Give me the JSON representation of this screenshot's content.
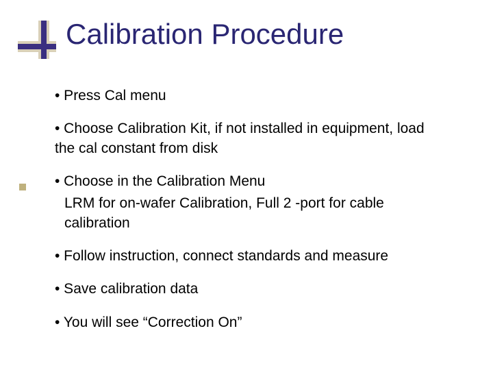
{
  "title": "Calibration Procedure",
  "bullets": {
    "b0": "• Press Cal menu",
    "b1": "• Choose Calibration Kit, if not installed in equipment, load the cal constant from disk",
    "b2": "• Choose in the Calibration Menu",
    "b2_sub": "LRM for on-wafer Calibration, Full 2 -port for cable calibration",
    "b3": "• Follow instruction, connect standards and measure",
    "b4": "• Save calibration data",
    "b5": "• You will see “Correction On”"
  }
}
